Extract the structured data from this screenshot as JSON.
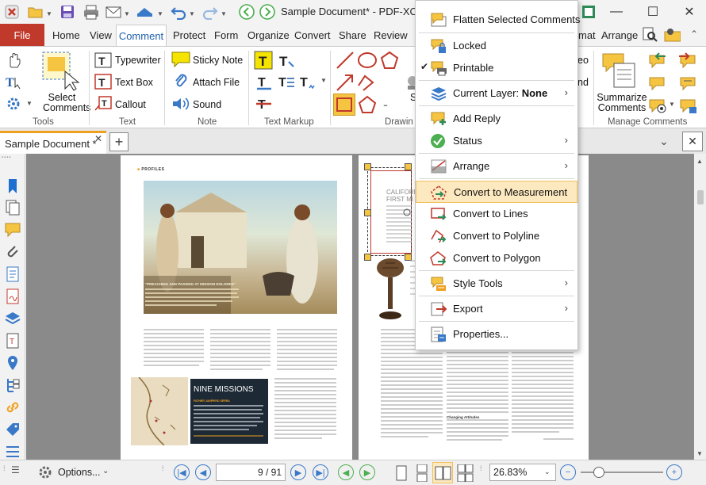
{
  "window": {
    "title": "Sample Document* - PDF-XCh..."
  },
  "ribbon_tabs": [
    "File",
    "Home",
    "View",
    "Comment",
    "Protect",
    "Form",
    "Organize",
    "Convert",
    "Share",
    "Review",
    "mat",
    "Arrange"
  ],
  "ribbon": {
    "tools_group": {
      "label": "Tools",
      "select_comments": "Select Comments"
    },
    "text_group": {
      "label": "Text",
      "typewriter": "Typewriter",
      "text_box": "Text Box",
      "callout": "Callout"
    },
    "note_group": {
      "label": "Note",
      "sticky_note": "Sticky Note",
      "attach_file": "Attach File",
      "sound": "Sound"
    },
    "text_markup_group": {
      "label": "Text Markup"
    },
    "drawing_group": {
      "label": "Drawin"
    },
    "right_partial": {
      "ol": "eo",
      "nd": "nd"
    },
    "manage_group": {
      "label": "Manage Comments",
      "summarize": "Summarize Comments"
    }
  },
  "document_tab": {
    "label": "Sample Document *"
  },
  "context_menu": {
    "items": [
      {
        "label": "Flatten Selected Comments",
        "icon": "flatten-icon"
      },
      {
        "label": "Locked",
        "icon": "lock-icon"
      },
      {
        "label": "Printable",
        "icon": "printer-icon",
        "checked": true
      },
      {
        "label": "Current Layer: ",
        "bold": "None",
        "icon": "layer-icon",
        "submenu": true
      },
      {
        "label": "Add Reply",
        "icon": "reply-icon"
      },
      {
        "label": "Status",
        "icon": "status-check-icon",
        "submenu": true
      },
      {
        "label": "Arrange",
        "icon": "arrange-icon",
        "submenu": true
      },
      {
        "label": "Convert to Measurement",
        "icon": "measure-icon",
        "highlighted": true
      },
      {
        "label": "Convert to Lines",
        "icon": "lines-icon"
      },
      {
        "label": "Convert to Polyline",
        "icon": "polyline-icon"
      },
      {
        "label": "Convert to Polygon",
        "icon": "polygon-icon"
      },
      {
        "label": "Style Tools",
        "icon": "style-icon",
        "submenu": true
      },
      {
        "label": "Export",
        "icon": "export-icon",
        "submenu": true
      },
      {
        "label": "Properties...",
        "icon": "properties-icon"
      }
    ]
  },
  "page_content": {
    "profiles_label": "PROFILES",
    "caption_title": "\"PREACHING AND PASSING AT MISSION DOLORES\"",
    "inset_title": "NINE MISSIONS",
    "inset_lead": "FATHER JUNÍPERO SERRA",
    "heading_calif": "CALIFORN",
    "heading_first": "FIRST MI",
    "subhead_changing": "Changing Attitudes"
  },
  "statusbar": {
    "options_label": "Options...",
    "page_indicator": "9 / 91",
    "zoom_value": "26.83%"
  }
}
